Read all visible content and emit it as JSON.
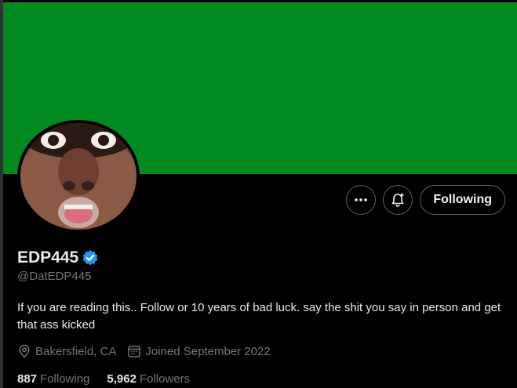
{
  "profile": {
    "display_name": "EDP445",
    "handle": "@DatEDP445",
    "verified": true,
    "bio": "If you are reading this.. Follow or 10 years of bad luck. say the shit you say in person and get that ass kicked",
    "location": "Bakersfield, CA",
    "joined": "Joined September 2022",
    "following_count": "887",
    "following_label": "Following",
    "followers_count": "5,962",
    "followers_label": "Followers"
  },
  "actions": {
    "more_icon": "more-dots-icon",
    "notify_icon": "notification-bell-icon",
    "follow_label": "Following"
  },
  "colors": {
    "banner": "#038a1e",
    "background": "#000000",
    "verified_badge": "#1d9bf0",
    "secondary_text": "#71767b",
    "primary_text": "#e7e9ea"
  }
}
